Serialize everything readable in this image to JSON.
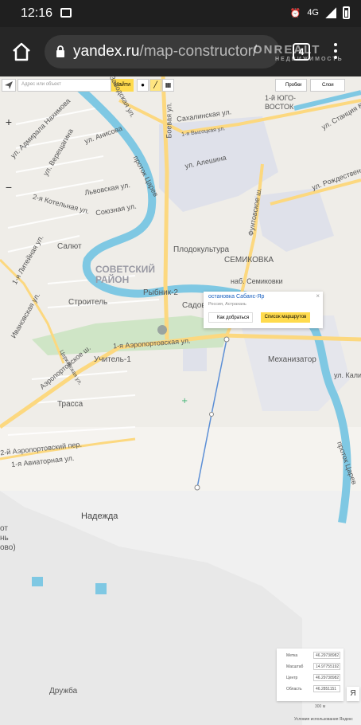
{
  "status_bar": {
    "time": "12:16",
    "network": "4G",
    "icons": [
      "gallery-icon",
      "alarm-icon",
      "signal-icon",
      "battery-icon"
    ]
  },
  "watermark": {
    "brand": "ONREALT",
    "tagline": "НЕДВИЖИМОСТЬ"
  },
  "browser": {
    "url_domain": "yandex.ru",
    "url_path": "/map-constructor/",
    "tab_count": "4",
    "icons": [
      "home-icon",
      "lock-icon",
      "tabs-icon",
      "overflow-menu-icon"
    ]
  },
  "toolbar": {
    "search_placeholder": "Адрес или объект",
    "find_label": "Найти",
    "traffic_label": "Пробки",
    "layers_label": "Слои"
  },
  "zoom": {
    "in": "+",
    "out": "−"
  },
  "map_labels": {
    "district": [
      "СОВЕТСКИЙ",
      "РАЙОН"
    ],
    "streets": [
      "Заводская ул.",
      "Боевая ул.",
      "Сахалинская ул.",
      "1-я Высоцкая ул.",
      "ул. Адмирала Нахимова",
      "ул. Верещагина",
      "ул. Анисова",
      "ул. Алешина",
      "проток Царев",
      "ул. Станция Кутум",
      "ул. Рождественского",
      "2-я Котельная ул.",
      "Львовская ул.",
      "Союзная ул.",
      "Фунтовское ш.",
      "1-я Литейная ул.",
      "наб. Семиковки",
      "1-я Аэропортовская ул.",
      "Аэропортовское ш.",
      "Церковская ул.",
      "ул. Калинина",
      "2-й Аэропортовский пер.",
      "1-я Авиаторная ул.",
      "Ивановская ул.",
      "Сибирская ул."
    ],
    "places": [
      "1-й ЮГО-",
      "ВОСТОК",
      "Плодокультура",
      "СЕМИКОВКА",
      "Салют",
      "Рыбник-2",
      "Строитель",
      "Садов",
      "Механизатор",
      "Учитель-1",
      "Трасса",
      "Надежда",
      "Дружба"
    ],
    "cut_off": [
      "от",
      "нь",
      "ово)"
    ]
  },
  "popup": {
    "title": "остановка Сабанс-Яр",
    "subtitle": "Россия, Астрахань",
    "how_to_get": "Как добраться",
    "routes": "Список маршрутов",
    "close": "×"
  },
  "info_panel": {
    "rows": [
      {
        "key": "Метка",
        "value": "46.29738982"
      },
      {
        "key": "Масштаб",
        "value": "14.97755192"
      },
      {
        "key": "Центр",
        "value": "46.29738982"
      },
      {
        "key": "Область",
        "value": "46.2851151"
      }
    ]
  },
  "scale_text": "300 м",
  "terms_text": "Условия использования",
  "yandex_logo": "Яндекс",
  "map_colors": {
    "water": "#7fc8e3",
    "major_road": "#fcd87f",
    "park": "#cfe5c6",
    "industrial": "#dfe1ea",
    "route_line": "#5c8fd6"
  }
}
